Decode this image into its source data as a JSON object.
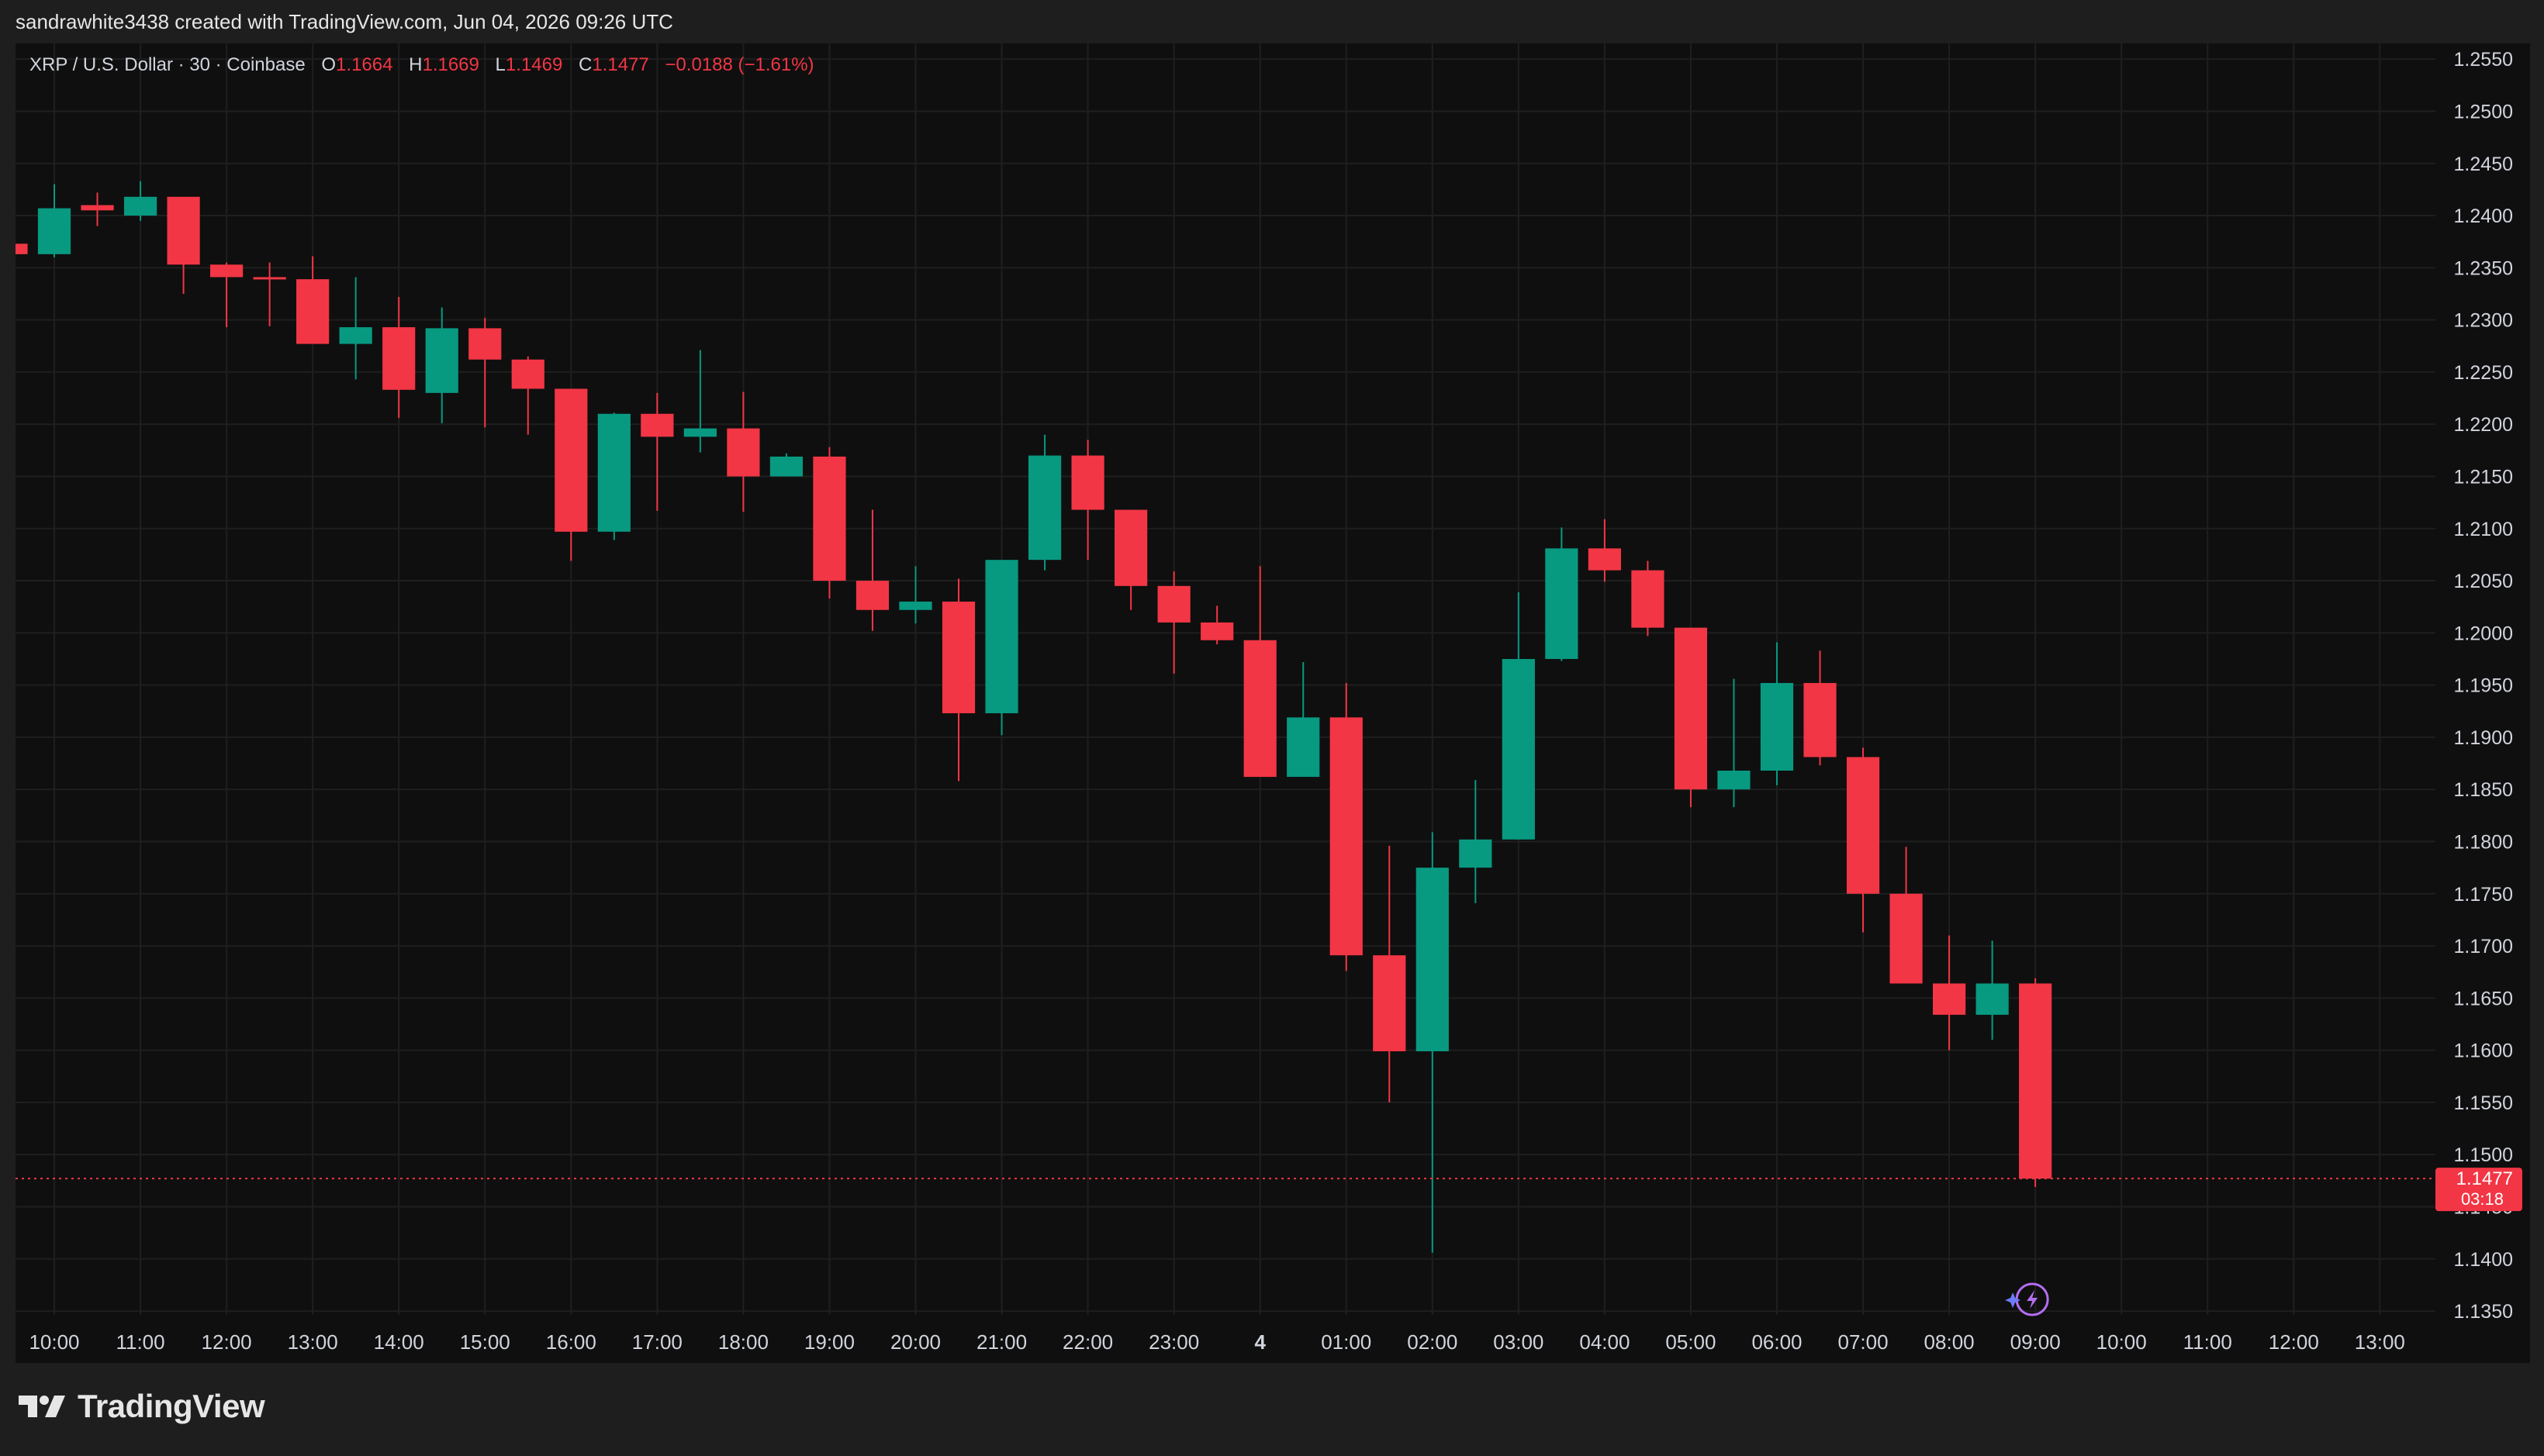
{
  "header": {
    "created_by": "sandrawhite3438 created with TradingView.com, Jun 04, 2026 09:26 UTC"
  },
  "legend": {
    "symbol": "XRP / U.S. Dollar · 30 · Coinbase",
    "open_label": "O",
    "open": "1.1664",
    "high_label": "H",
    "high": "1.1669",
    "low_label": "L",
    "low": "1.1469",
    "close_label": "C",
    "close": "1.1477",
    "change": "−0.0188 (−1.61%)"
  },
  "price_tag": {
    "price": "1.1477",
    "countdown": "03:18"
  },
  "brand": {
    "name": "TradingView"
  },
  "colors": {
    "up": "#089981",
    "down": "#f23645",
    "background": "#0f0f0f",
    "grid": "#1f1f1f",
    "text": "#d1d4dc"
  },
  "chart_data": {
    "type": "candlestick",
    "ylim": [
      1.133,
      1.2565
    ],
    "y_ticks": [
      "1.1350",
      "1.1400",
      "1.1450",
      "1.1500",
      "1.1550",
      "1.1600",
      "1.1650",
      "1.1700",
      "1.1750",
      "1.1800",
      "1.1850",
      "1.1900",
      "1.1950",
      "1.2000",
      "1.2050",
      "1.2100",
      "1.2150",
      "1.2200",
      "1.2250",
      "1.2300",
      "1.2350",
      "1.2400",
      "1.2450",
      "1.2500",
      "1.2550"
    ],
    "x_labels": [
      "10:00",
      "11:00",
      "12:00",
      "13:00",
      "14:00",
      "15:00",
      "16:00",
      "17:00",
      "18:00",
      "19:00",
      "20:00",
      "21:00",
      "22:00",
      "23:00",
      "4",
      "01:00",
      "02:00",
      "03:00",
      "04:00",
      "05:00",
      "06:00",
      "07:00",
      "08:00",
      "09:00",
      "10:00",
      "11:00",
      "12:00",
      "13:00"
    ],
    "x_label_bold_index": 14,
    "candle_slot": 0.5,
    "last_price": 1.1477,
    "candles": [
      {
        "t": -0.5,
        "o": 1.2373,
        "h": 1.2373,
        "l": 1.2363,
        "c": 1.2363
      },
      {
        "t": 0,
        "o": 1.2363,
        "h": 1.243,
        "l": 1.236,
        "c": 1.2407
      },
      {
        "t": 0.5,
        "o": 1.241,
        "h": 1.2422,
        "l": 1.239,
        "c": 1.2405
      },
      {
        "t": 1,
        "o": 1.24,
        "h": 1.2433,
        "l": 1.2395,
        "c": 1.2418
      },
      {
        "t": 1.5,
        "o": 1.2418,
        "h": 1.2418,
        "l": 1.2325,
        "c": 1.2353
      },
      {
        "t": 2,
        "o": 1.2353,
        "h": 1.2355,
        "l": 1.2293,
        "c": 1.2341
      },
      {
        "t": 2.5,
        "o": 1.2341,
        "h": 1.2355,
        "l": 1.2294,
        "c": 1.2339
      },
      {
        "t": 3,
        "o": 1.2339,
        "h": 1.2361,
        "l": 1.2277,
        "c": 1.2277
      },
      {
        "t": 3.5,
        "o": 1.2277,
        "h": 1.2341,
        "l": 1.2243,
        "c": 1.2293
      },
      {
        "t": 4,
        "o": 1.2293,
        "h": 1.2322,
        "l": 1.2206,
        "c": 1.2233
      },
      {
        "t": 4.5,
        "o": 1.223,
        "h": 1.2312,
        "l": 1.2201,
        "c": 1.2292
      },
      {
        "t": 5,
        "o": 1.2292,
        "h": 1.2302,
        "l": 1.2197,
        "c": 1.2262
      },
      {
        "t": 5.5,
        "o": 1.2262,
        "h": 1.2265,
        "l": 1.219,
        "c": 1.2234
      },
      {
        "t": 6,
        "o": 1.2234,
        "h": 1.2234,
        "l": 1.2069,
        "c": 1.2097
      },
      {
        "t": 6.5,
        "o": 1.2097,
        "h": 1.2211,
        "l": 1.2089,
        "c": 1.221
      },
      {
        "t": 7,
        "o": 1.221,
        "h": 1.223,
        "l": 1.2117,
        "c": 1.2188
      },
      {
        "t": 7.5,
        "o": 1.2188,
        "h": 1.2271,
        "l": 1.2173,
        "c": 1.2196
      },
      {
        "t": 8,
        "o": 1.2196,
        "h": 1.2231,
        "l": 1.2116,
        "c": 1.215
      },
      {
        "t": 8.5,
        "o": 1.215,
        "h": 1.2172,
        "l": 1.215,
        "c": 1.2169
      },
      {
        "t": 9,
        "o": 1.2169,
        "h": 1.2178,
        "l": 1.2033,
        "c": 1.205
      },
      {
        "t": 9.5,
        "o": 1.205,
        "h": 1.2118,
        "l": 1.2002,
        "c": 1.2022
      },
      {
        "t": 10,
        "o": 1.2022,
        "h": 1.2064,
        "l": 1.2009,
        "c": 1.203
      },
      {
        "t": 10.5,
        "o": 1.203,
        "h": 1.2052,
        "l": 1.1858,
        "c": 1.1923
      },
      {
        "t": 11,
        "o": 1.1923,
        "h": 1.207,
        "l": 1.1902,
        "c": 1.207
      },
      {
        "t": 11.5,
        "o": 1.207,
        "h": 1.219,
        "l": 1.206,
        "c": 1.217
      },
      {
        "t": 12,
        "o": 1.217,
        "h": 1.2185,
        "l": 1.207,
        "c": 1.2118
      },
      {
        "t": 12.5,
        "o": 1.2118,
        "h": 1.2118,
        "l": 1.2022,
        "c": 1.2045
      },
      {
        "t": 13,
        "o": 1.2045,
        "h": 1.2059,
        "l": 1.1961,
        "c": 1.201
      },
      {
        "t": 13.5,
        "o": 1.201,
        "h": 1.2026,
        "l": 1.1989,
        "c": 1.1993
      },
      {
        "t": 14,
        "o": 1.1993,
        "h": 1.2064,
        "l": 1.1862,
        "c": 1.1862
      },
      {
        "t": 14.5,
        "o": 1.1862,
        "h": 1.1972,
        "l": 1.1862,
        "c": 1.1919
      },
      {
        "t": 15,
        "o": 1.1919,
        "h": 1.1952,
        "l": 1.1676,
        "c": 1.1691
      },
      {
        "t": 15.5,
        "o": 1.1691,
        "h": 1.1796,
        "l": 1.155,
        "c": 1.1599
      },
      {
        "t": 16,
        "o": 1.1599,
        "h": 1.1809,
        "l": 1.1406,
        "c": 1.1775
      },
      {
        "t": 16.5,
        "o": 1.1775,
        "h": 1.1859,
        "l": 1.1741,
        "c": 1.1802
      },
      {
        "t": 17,
        "o": 1.1802,
        "h": 1.2039,
        "l": 1.1802,
        "c": 1.1975
      },
      {
        "t": 17.5,
        "o": 1.1975,
        "h": 1.2101,
        "l": 1.1973,
        "c": 1.2081
      },
      {
        "t": 18,
        "o": 1.2081,
        "h": 1.2109,
        "l": 1.2049,
        "c": 1.206
      },
      {
        "t": 18.5,
        "o": 1.206,
        "h": 1.2069,
        "l": 1.1997,
        "c": 1.2005
      },
      {
        "t": 19,
        "o": 1.2005,
        "h": 1.2005,
        "l": 1.1833,
        "c": 1.185
      },
      {
        "t": 19.5,
        "o": 1.185,
        "h": 1.1956,
        "l": 1.1833,
        "c": 1.1868
      },
      {
        "t": 20,
        "o": 1.1868,
        "h": 1.1991,
        "l": 1.1854,
        "c": 1.1952
      },
      {
        "t": 20.5,
        "o": 1.1952,
        "h": 1.1983,
        "l": 1.1873,
        "c": 1.1881
      },
      {
        "t": 21,
        "o": 1.1881,
        "h": 1.189,
        "l": 1.1713,
        "c": 1.175
      },
      {
        "t": 21.5,
        "o": 1.175,
        "h": 1.1795,
        "l": 1.1664,
        "c": 1.1664
      },
      {
        "t": 22,
        "o": 1.1664,
        "h": 1.171,
        "l": 1.16,
        "c": 1.1634
      },
      {
        "t": 22.5,
        "o": 1.1634,
        "h": 1.1705,
        "l": 1.161,
        "c": 1.1664
      },
      {
        "t": 23,
        "o": 1.1664,
        "h": 1.1669,
        "l": 1.1469,
        "c": 1.1477
      }
    ]
  }
}
